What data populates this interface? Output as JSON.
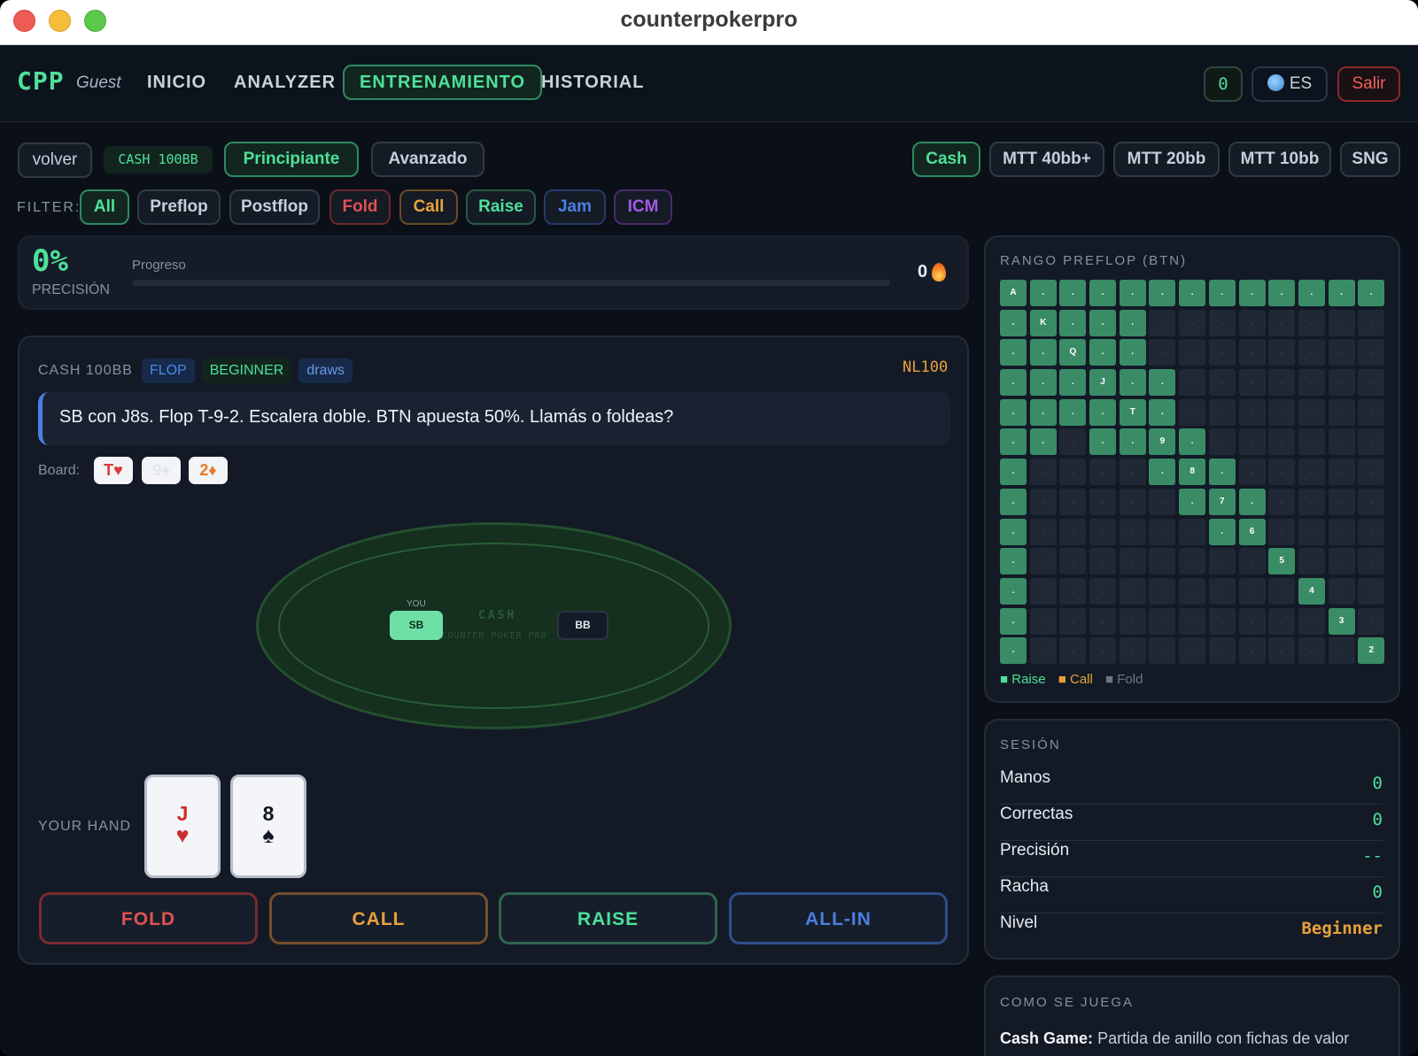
{
  "window": {
    "title": "counterpokerpro"
  },
  "nav": {
    "logo": "CPP",
    "user": "Guest",
    "links": [
      "INICIO",
      "ANALYZER",
      "ENTRENAMIENTO",
      "HISTORIAL"
    ],
    "points": "0",
    "lang": "ES",
    "logout": "Salir"
  },
  "toolbar": {
    "back": "volver",
    "stack_badge": "CASH 100BB",
    "levels": [
      "Principiante",
      "Avanzado"
    ],
    "formats": [
      "Cash",
      "MTT 40bb+",
      "MTT 20bb",
      "MTT 10bb",
      "SNG"
    ]
  },
  "filter": {
    "label": "FILTER:",
    "options": [
      "All",
      "Preflop",
      "Postflop",
      "Fold",
      "Call",
      "Raise",
      "Jam",
      "ICM"
    ]
  },
  "progress": {
    "accuracy": "0%",
    "accuracy_label": "PRECISIÓN",
    "label": "Progreso",
    "streak": "0",
    "streak_icon": "fire-icon",
    "value": 0
  },
  "scenario": {
    "game": "CASH 100BB",
    "tags": [
      "FLOP",
      "BEGINNER",
      "draws"
    ],
    "stakes": "NL100",
    "question": "SB con J8s. Flop T-9-2. Escalera doble. BTN apuesta 50%. Llamás o foldeas?",
    "board_label": "Board:",
    "board": [
      {
        "rank": "T",
        "suit": "♥",
        "color": "#d93a3a"
      },
      {
        "rank": "9",
        "suit": "♠",
        "color": "#e3e7ed"
      },
      {
        "rank": "2",
        "suit": "♦",
        "color": "#e8782a"
      }
    ]
  },
  "table": {
    "center_title": "CASH",
    "center_sub": "COUNTER POKER PRO",
    "hero_label": "YOU",
    "hero_seat": "SB",
    "villain_seat": "BB"
  },
  "hand": {
    "label": "YOUR HAND",
    "cards": [
      {
        "rank": "J",
        "suit": "♥",
        "color": "#cc2d2d"
      },
      {
        "rank": "8",
        "suit": "♠",
        "color": "#121722"
      }
    ]
  },
  "actions": [
    "FOLD",
    "CALL",
    "RAISE",
    "ALL-IN"
  ],
  "range": {
    "title": "RANGO PREFLOP (BTN)",
    "ranks": [
      "A",
      "K",
      "Q",
      "J",
      "T",
      "9",
      "8",
      "7",
      "6",
      "5",
      "4",
      "3",
      "2"
    ],
    "legend": [
      "Raise",
      "Call",
      "Fold"
    ],
    "rows": [
      "rrrrrrrrrrrrr",
      "rrrrrffffffff",
      "rrrrrffffffff",
      "rrrrrrfffffff",
      "rrrrrrfffffff",
      "rrfrrrrffffff",
      "rffffrrrfffff",
      "rfffffrrrffff",
      "rffffffrrffff",
      "rffffffffrfff",
      "rfffffffffrff",
      "rffffffffffrf",
      "rfffffffffffr"
    ]
  },
  "session": {
    "title": "SESIÓN",
    "rows": [
      {
        "label": "Manos",
        "value": "0"
      },
      {
        "label": "Correctas",
        "value": "0"
      },
      {
        "label": "Precisión",
        "value": "--"
      },
      {
        "label": "Racha",
        "value": "0"
      },
      {
        "label": "Nivel",
        "value": "Beginner"
      }
    ]
  },
  "howto": {
    "title": "COMO SE JUEGA",
    "bold": "Cash Game:",
    "text": "Partida de anillo con fichas de valor"
  },
  "colors": {
    "accent": "#4ee09a",
    "fold": "#e05252",
    "call": "#e8a13a",
    "raise": "#4ee09a",
    "jam": "#4a7fe0",
    "icm": "#a45ae8"
  }
}
